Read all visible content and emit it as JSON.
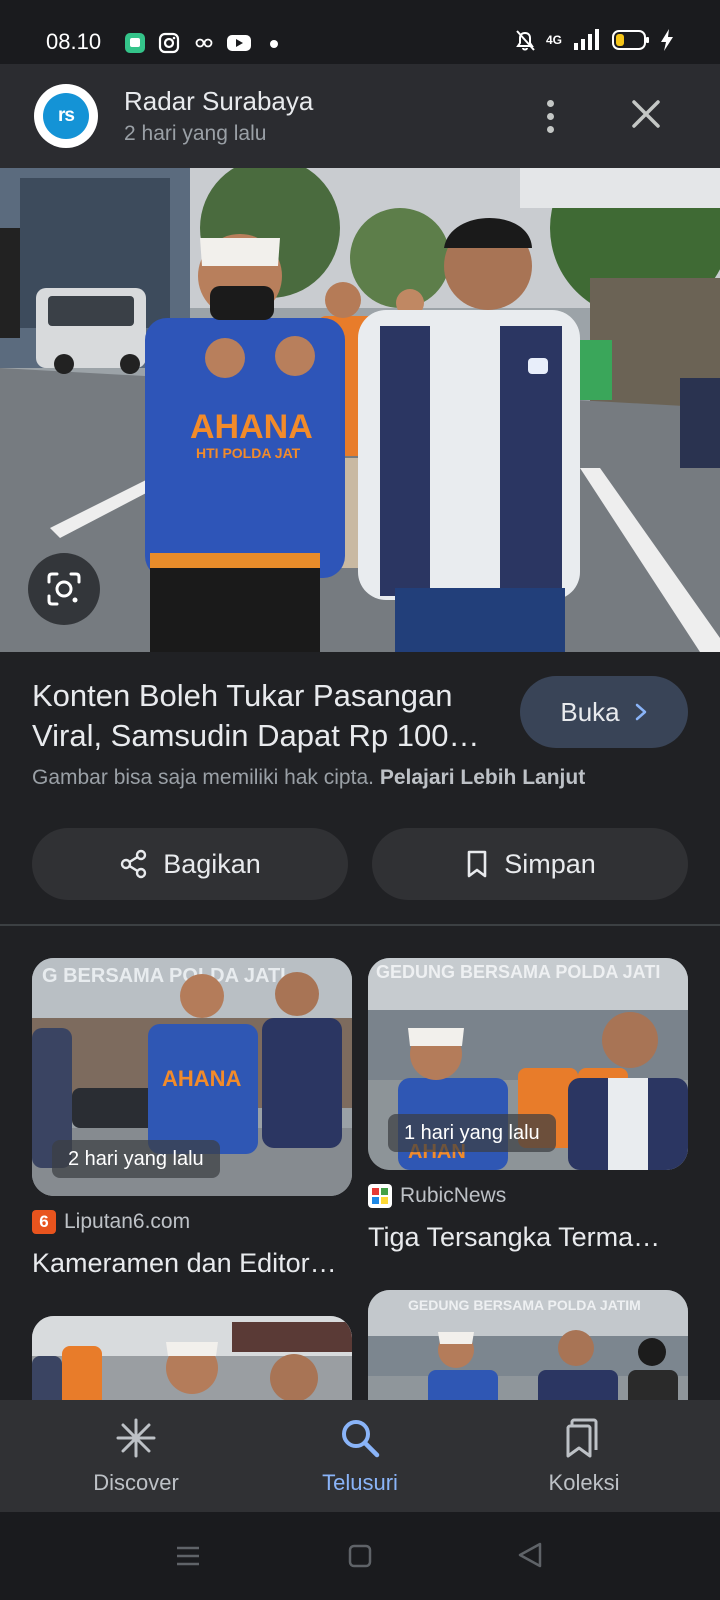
{
  "status_bar": {
    "time": "08.10",
    "network": "4G",
    "icons": [
      "chat-app-icon",
      "instagram-icon",
      "link-icon",
      "youtube-icon",
      "dot-icon",
      "mute-icon",
      "signal-icon",
      "battery-low-icon",
      "charging-icon"
    ]
  },
  "header": {
    "logo_text": "rs",
    "source_name": "Radar Surabaya",
    "timestamp": "2 hari yang lalu"
  },
  "hero": {
    "vest_text_1": "AHANA",
    "vest_text_2": "HTI POLDA JAT"
  },
  "article": {
    "title": "Konten Boleh Tukar Pasangan Viral, Samsudin Dapat Rp 100…",
    "open_label": "Buka",
    "copyright_text": "Gambar bisa saja memiliki hak cipta.",
    "learn_more": "Pelajari Lebih Lanjut",
    "share_label": "Bagikan",
    "save_label": "Simpan"
  },
  "results": [
    {
      "banner": "G BERSAMA POLDA JATI",
      "vest_text": "AHANA",
      "time": "2 hari yang lalu",
      "source": "Liputan6.com",
      "title": "Kameramen dan Editor…"
    },
    {
      "banner": "GEDUNG BERSAMA POLDA JATI",
      "vest_text": "AHAN",
      "time": "1 hari yang lalu",
      "source": "RubicNews",
      "title": "Tiga Tersangka Terma…"
    },
    {
      "banner": ""
    },
    {
      "banner": "GEDUNG BERSAMA POLDA JATIM"
    }
  ],
  "bottom_nav": {
    "items": [
      {
        "label": "Discover",
        "icon": "asterisk-icon"
      },
      {
        "label": "Telusuri",
        "icon": "search-icon",
        "active": true
      },
      {
        "label": "Koleksi",
        "icon": "collections-icon"
      }
    ]
  },
  "colors": {
    "background": "#202124",
    "accent": "#8ab4f8",
    "open_button": "#394457"
  }
}
